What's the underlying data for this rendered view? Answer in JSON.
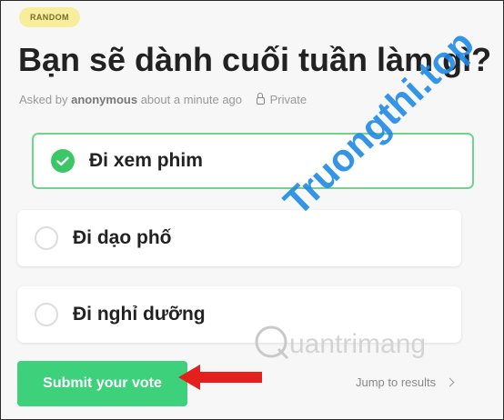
{
  "poll": {
    "badge": "RANDOM",
    "title": "Bạn sẽ dành cuối tuần làm gì?",
    "meta_prefix": "Asked by",
    "author": "anonymous",
    "meta_time": "about a minute ago",
    "privacy": "Private"
  },
  "options": [
    {
      "label": "Đi xem phim",
      "selected": true
    },
    {
      "label": "Đi dạo phố",
      "selected": false
    },
    {
      "label": "Đi nghỉ dưỡng",
      "selected": false
    }
  ],
  "actions": {
    "submit_label": "Submit your vote",
    "jump_label": "Jump to results"
  },
  "watermarks": {
    "diagonal": "Truongthi.top",
    "bottom": "uantrimang"
  },
  "colors": {
    "badge_bg": "#f6ee9a",
    "selected_border": "#6fd58b",
    "check_green": "#3cc767",
    "submit_green": "#3dd17b",
    "arrow_red": "#e3201b",
    "watermark_blue": "#1e88e5",
    "watermark_orange": "#f57c00"
  },
  "icons": {
    "check": "check-circle-icon",
    "lock": "lock-icon",
    "chevron": "chevron-right-icon",
    "arrow": "red-arrow-left-icon"
  }
}
